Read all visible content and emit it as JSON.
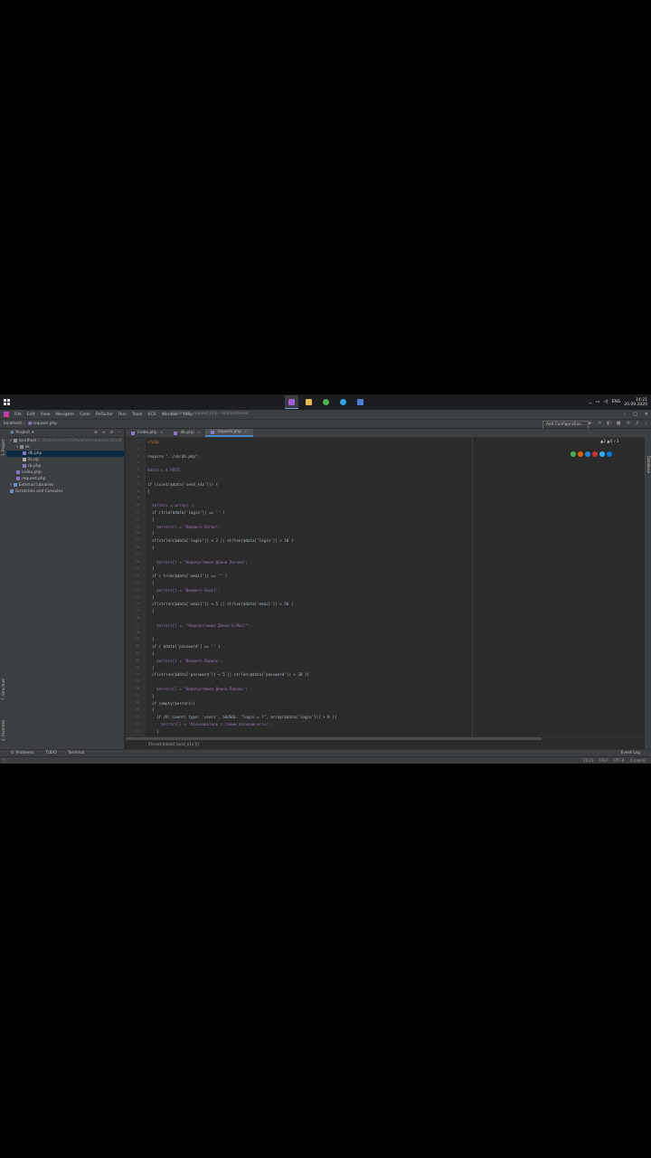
{
  "taskbar": {
    "apps": [
      {
        "name": "phpstorm",
        "color": "#a35bd8",
        "active": true
      },
      {
        "name": "explorer",
        "color": "#e8b84a",
        "active": false
      },
      {
        "name": "chrome",
        "color": "#4caf50",
        "active": false
      },
      {
        "name": "telegram",
        "color": "#2ca5e0",
        "active": false
      },
      {
        "name": "windows-app",
        "color": "#4a7fd6",
        "active": false
      }
    ],
    "lang": "ENG",
    "time": "14:21",
    "date": "20.09.2020"
  },
  "menubar": {
    "items": [
      "File",
      "Edit",
      "View",
      "Navigate",
      "Code",
      "Refactor",
      "Run",
      "Tools",
      "VCS",
      "Window",
      "Help"
    ],
    "title": "localhost - request.php - Administrator"
  },
  "navbar": {
    "breadcrumb_root": "localhost",
    "breadcrumb_file": "request.php",
    "add_configuration": "Add Configuration..."
  },
  "left_tools": {
    "project_tab": "1: Project",
    "structure_tab": "7: Structure",
    "favorites_tab": "2: Favorites"
  },
  "right_tools": {
    "database_tab": "Database"
  },
  "project_panel": {
    "header": "Project",
    "tree": [
      {
        "label": "localhost",
        "path": " C:\\OpenServer\\OSPanel\\domains\\localhost",
        "indent": 0,
        "icon": "folder-icon",
        "color": "#8c8c8c",
        "selected": false
      },
      {
        "label": "ok",
        "path": "",
        "indent": 1,
        "icon": "folder-icon",
        "color": "#8c8c8c",
        "selected": false
      },
      {
        "label": "db.php",
        "path": "",
        "indent": 2,
        "icon": "php-file-icon",
        "color": "#8e74c4",
        "selected": true
      },
      {
        "label": "ib.sql",
        "path": "",
        "indent": 2,
        "icon": "sql-file-icon",
        "color": "#aaaaaa",
        "selected": false
      },
      {
        "label": "rb.php",
        "path": "",
        "indent": 2,
        "icon": "php-file-icon",
        "color": "#8e74c4",
        "selected": false
      },
      {
        "label": "index.php",
        "path": "",
        "indent": 1,
        "icon": "php-file-icon",
        "color": "#8e74c4",
        "selected": false
      },
      {
        "label": "request.php",
        "path": "",
        "indent": 1,
        "icon": "php-file-icon",
        "color": "#8e74c4",
        "selected": false
      },
      {
        "label": "External Libraries",
        "path": "",
        "indent": 0,
        "icon": "library-icon",
        "color": "#6a8fc7",
        "selected": false
      },
      {
        "label": "Scratches and Consoles",
        "path": "",
        "indent": 0,
        "icon": "scratch-icon",
        "color": "#6a8fc7",
        "selected": false
      }
    ]
  },
  "tabs": [
    {
      "label": "index.php",
      "active": false
    },
    {
      "label": "db.php",
      "active": false
    },
    {
      "label": "request.php",
      "active": true
    }
  ],
  "editor": {
    "inspection": "▲2 ▲4 ✓1",
    "code_lines": [
      {
        "n": "1",
        "t": "<?php",
        "c": "kw"
      },
      {
        "n": "2",
        "t": "",
        "c": ""
      },
      {
        "n": "3",
        "t": "require \"../ok/db.php\";",
        "c": ""
      },
      {
        "n": "4",
        "t": "",
        "c": ""
      },
      {
        "n": "5",
        "t": "$data = $_POST;",
        "c": "var"
      },
      {
        "n": "6",
        "t": "",
        "c": ""
      },
      {
        "n": "7",
        "t": "if (isset($data['send_e1s'])) {",
        "c": ""
      },
      {
        "n": "8",
        "t": "{",
        "c": ""
      },
      {
        "n": "9",
        "t": "",
        "c": ""
      },
      {
        "n": "10",
        "t": "  $errors = array( );",
        "c": "var"
      },
      {
        "n": "11",
        "t": "  if (trim($data['login']) == '' )",
        "c": ""
      },
      {
        "n": "12",
        "t": "  {",
        "c": ""
      },
      {
        "n": "13",
        "t": "    $errors[] = 'Введите Логин';",
        "c": "var"
      },
      {
        "n": "14",
        "t": "  }",
        "c": ""
      },
      {
        "n": "15",
        "t": "  if(strlen($data['login']) < 2 || strlen($data['login']) > 10 )",
        "c": ""
      },
      {
        "n": "16",
        "t": "  {",
        "c": ""
      },
      {
        "n": "17",
        "t": "",
        "c": ""
      },
      {
        "n": "18",
        "t": "    $errors[] = \"Недопустимая Длина Логина\";",
        "c": "var"
      },
      {
        "n": "19",
        "t": "  }",
        "c": ""
      },
      {
        "n": "20",
        "t": "  if ( trim($data['email']) == '' )",
        "c": ""
      },
      {
        "n": "21",
        "t": "  {",
        "c": ""
      },
      {
        "n": "22",
        "t": "    $errors[] = 'Введите Email';",
        "c": "var"
      },
      {
        "n": "23",
        "t": "  }",
        "c": ""
      },
      {
        "n": "24",
        "t": "  if(strlen($data['email']) < 5 || strlen($data['email']) > 56 )",
        "c": ""
      },
      {
        "n": "25",
        "t": "  {",
        "c": ""
      },
      {
        "n": "26",
        "t": "",
        "c": ""
      },
      {
        "n": "27",
        "t": "    $errors[] =  \"Недопустимая Длина E-Mail\";",
        "c": "var"
      },
      {
        "n": "28",
        "t": "",
        "c": ""
      },
      {
        "n": "29",
        "t": "  }",
        "c": ""
      },
      {
        "n": "30",
        "t": "  if ( $data['password'] == '' )",
        "c": ""
      },
      {
        "n": "31",
        "t": "  {",
        "c": ""
      },
      {
        "n": "32",
        "t": "    $errors[] = 'Введите Пароль';",
        "c": "var"
      },
      {
        "n": "33",
        "t": "  }",
        "c": ""
      },
      {
        "n": "34",
        "t": "  if(strlen($data['password']) < 5 || strlen($data['password']) > 20 ){",
        "c": ""
      },
      {
        "n": "35",
        "t": "",
        "c": ""
      },
      {
        "n": "36",
        "t": "    $errors[] = \"Недопустимая Длина Пароль\";",
        "c": "var"
      },
      {
        "n": "37",
        "t": "  }",
        "c": ""
      },
      {
        "n": "38",
        "t": "  if (empty($errors))",
        "c": ""
      },
      {
        "n": "39",
        "t": "  {",
        "c": ""
      },
      {
        "n": "40",
        "t": "    if (R::count( type: 'users', addSQL: \"login = ?\", array($data['login'])) > 0 ){",
        "c": ""
      },
      {
        "n": "41",
        "t": "      $errors[] = 'Пользователь с таким логином есть!';",
        "c": "var"
      },
      {
        "n": "42",
        "t": "    }",
        "c": ""
      }
    ]
  },
  "breadcrumb_bottom": "if(isset($data['send_e1s']))",
  "tool_windows": {
    "problems": "6: Problems",
    "todo": "TODO",
    "terminal": "Terminal",
    "event_log": "Event Log"
  },
  "status": {
    "position": "26:21",
    "line_sep": "CRLF",
    "encoding": "UTF-8",
    "indent": "4 spaces"
  }
}
